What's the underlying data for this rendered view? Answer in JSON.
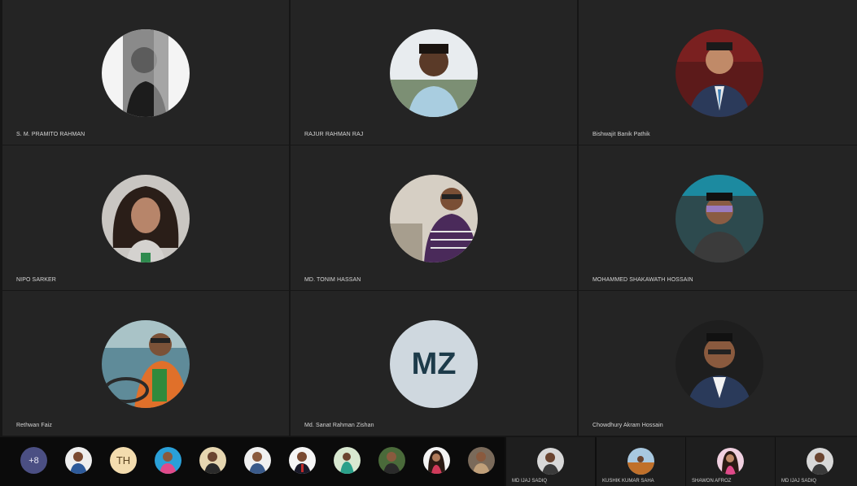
{
  "participants": [
    {
      "name": "S. M. PRAMITO RAHMAN"
    },
    {
      "name": "RAJUR RAHMAN RAJ"
    },
    {
      "name": "Bishwajit Banik Pathik"
    },
    {
      "name": "NIPO SARKER"
    },
    {
      "name": "MD. TONIM HASSAN"
    },
    {
      "name": "MOHAMMED SHAKAWATH HOSSAIN"
    },
    {
      "name": "Rethwan Faiz"
    },
    {
      "name": "Md. Sanat Rahman Zishan",
      "initials": "MZ"
    },
    {
      "name": "Chowdhury Akram Hossain"
    }
  ],
  "overflow_strip": {
    "more_count": "+8",
    "initials_avatar": "TH"
  },
  "side_tiles": [
    {
      "name": "MD IJAJ SADIQ"
    },
    {
      "name": "KUSHIK KUMAR SAHA"
    },
    {
      "name": "SHAWON AFROZ"
    },
    {
      "name": "MD IJAJ SADIQ"
    }
  ],
  "colors": {
    "tile_background": "#242424",
    "more_badge": "#4b4f83",
    "initials_avatar_bg": "#cfd8df",
    "strip_initials_bg": "#f3dcae"
  }
}
